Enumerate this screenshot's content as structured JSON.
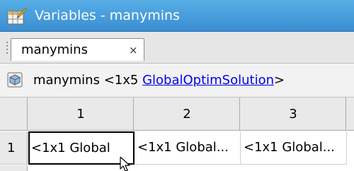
{
  "window": {
    "title": "Variables - manymins",
    "icon": "variables-editor-icon"
  },
  "tabs": [
    {
      "label": "manymins",
      "close_glyph": "×",
      "active": true
    }
  ],
  "infobar": {
    "variable_name": "manymins",
    "size_prefix": "<1x5 ",
    "class_link": "GlobalOptimSolution",
    "size_suffix": ">",
    "icon": "struct-array-icon"
  },
  "table": {
    "column_headers": [
      "1",
      "2",
      "3"
    ],
    "row_headers": [
      "1"
    ],
    "cells": [
      [
        "<1x1 Global",
        "<1x1 Global...",
        "<1x1 Global..."
      ]
    ],
    "selected_cell": "1,1"
  },
  "colors": {
    "titlebar": "#3a8ed2",
    "link": "#0000ee",
    "header_bg": "#e9e9e9"
  }
}
